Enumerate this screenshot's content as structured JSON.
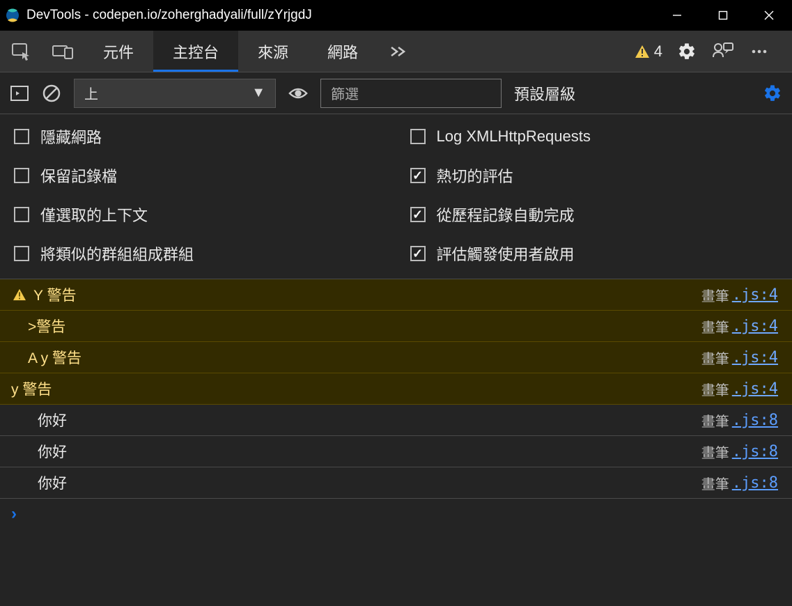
{
  "titlebar": {
    "title": "DevTools - codepen.io/zoherghadyali/full/zYrjgdJ"
  },
  "tabs": {
    "elements": "元件",
    "console": "主控台",
    "sources": "來源",
    "network": "網路",
    "warning_count": "4"
  },
  "toolbar": {
    "context": "上",
    "filter_placeholder": "篩選",
    "levels_label": "預設層級"
  },
  "options": {
    "hide_network": "隱藏網路",
    "log_xhr": "Log XMLHttpRequests",
    "preserve_log": "保留記錄檔",
    "eager_eval": "熱切的評估",
    "selected_only": "僅選取的上下文",
    "autocomplete_history": "從歷程記錄自動完成",
    "group_similar": "將類似的群組組成群組",
    "eval_triggers": "評估觸發使用者啟用"
  },
  "console": {
    "source_prefix": "畫筆",
    "rows": [
      {
        "type": "warn",
        "msg": "Y 警告",
        "link": ".js:4",
        "icon": true,
        "indent": 0
      },
      {
        "type": "warn",
        "msg": "&gt;警告",
        "link": ".js:4",
        "icon": false,
        "indent": 1
      },
      {
        "type": "warn",
        "msg": "A y 警告",
        "link": ".js:4",
        "icon": false,
        "indent": 1
      },
      {
        "type": "warn",
        "msg": "y 警告",
        "link": ".js:4",
        "icon": false,
        "indent": 0,
        "nopad": true
      },
      {
        "type": "log",
        "msg": "你好",
        "link": ".js:8",
        "icon": false,
        "indent": 2
      },
      {
        "type": "log",
        "msg": "你好",
        "link": ".js:8",
        "icon": false,
        "indent": 2
      },
      {
        "type": "log",
        "msg": "你好",
        "link": ".js:8",
        "icon": false,
        "indent": 2
      }
    ]
  }
}
